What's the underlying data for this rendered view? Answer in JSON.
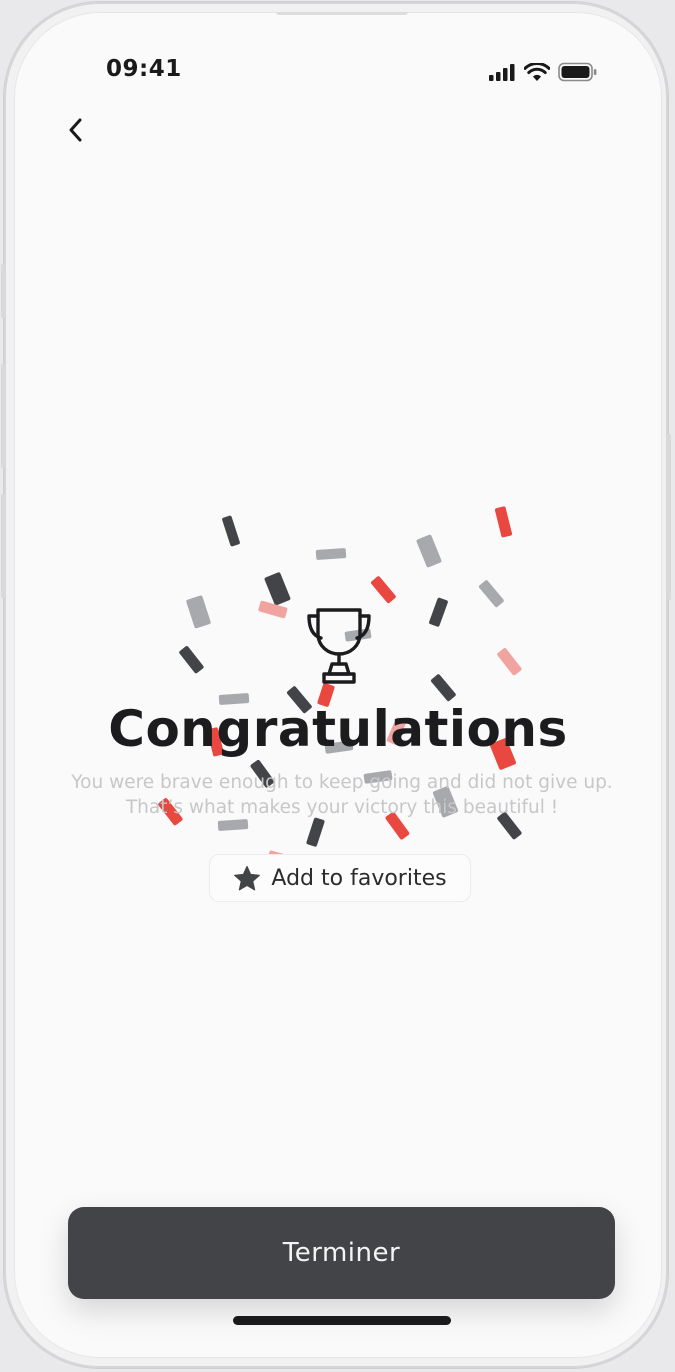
{
  "status_bar": {
    "time": "09:41",
    "icons": [
      "cellular-icon",
      "wifi-icon",
      "battery-icon"
    ]
  },
  "nav": {
    "back_icon": "chevron-left-icon"
  },
  "content": {
    "icon": "trophy-icon",
    "title": "Congratulations",
    "subtitle": "You were brave enough to keep going and did not give up. That’s what makes your victory this beautiful !",
    "favorite_button": {
      "icon": "star-icon",
      "label": "Add to favorites"
    }
  },
  "primary_button": {
    "label": "Terminer"
  },
  "colors": {
    "accent_red": "#e8483f",
    "accent_pink": "#f1a3a0",
    "dark": "#434447",
    "gray": "#a8a9ac",
    "background": "#fafafa"
  }
}
